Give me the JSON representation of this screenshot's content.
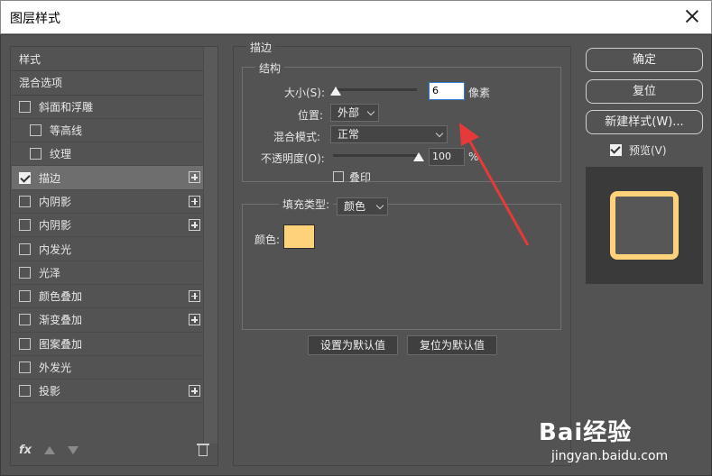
{
  "window": {
    "title": "图层样式"
  },
  "left_panel": {
    "items": [
      {
        "label": "样式",
        "type": "header"
      },
      {
        "label": "混合选项",
        "type": "header"
      },
      {
        "label": "斜面和浮雕",
        "checked": false,
        "plus": false
      },
      {
        "label": "等高线",
        "checked": false,
        "indent": true
      },
      {
        "label": "纹理",
        "checked": false,
        "indent": true
      },
      {
        "label": "描边",
        "checked": true,
        "plus": true,
        "selected": true
      },
      {
        "label": "内阴影",
        "checked": false,
        "plus": true
      },
      {
        "label": "内阴影",
        "checked": false,
        "plus": true
      },
      {
        "label": "内发光",
        "checked": false
      },
      {
        "label": "光泽",
        "checked": false
      },
      {
        "label": "颜色叠加",
        "checked": false,
        "plus": true
      },
      {
        "label": "渐变叠加",
        "checked": false,
        "plus": true
      },
      {
        "label": "图案叠加",
        "checked": false
      },
      {
        "label": "外发光",
        "checked": false
      },
      {
        "label": "投影",
        "checked": false,
        "plus": true
      }
    ],
    "footer": {
      "fx_label": "fx"
    }
  },
  "stroke": {
    "section_title": "描边",
    "structure": {
      "title": "结构",
      "size_label": "大小(S):",
      "size_value": "6",
      "size_unit": "像素",
      "position_label": "位置:",
      "position_value": "外部",
      "blend_label": "混合模式:",
      "blend_value": "正常",
      "opacity_label": "不透明度(O):",
      "opacity_value": "100",
      "opacity_unit": "%",
      "overprint_label": "叠印"
    },
    "fill": {
      "type_label": "填充类型:",
      "type_value": "颜色",
      "color_label": "颜色:",
      "color": "#fdd27a"
    },
    "buttons": {
      "set_default": "设置为默认值",
      "reset_default": "复位为默认值"
    }
  },
  "right_panel": {
    "ok": "确定",
    "reset": "复位",
    "new_style": "新建样式(W)...",
    "preview_label": "预览(V)",
    "preview_checked": true
  },
  "watermark": {
    "line1": "Bai经验",
    "line2": "jingyan.baidu.com"
  }
}
